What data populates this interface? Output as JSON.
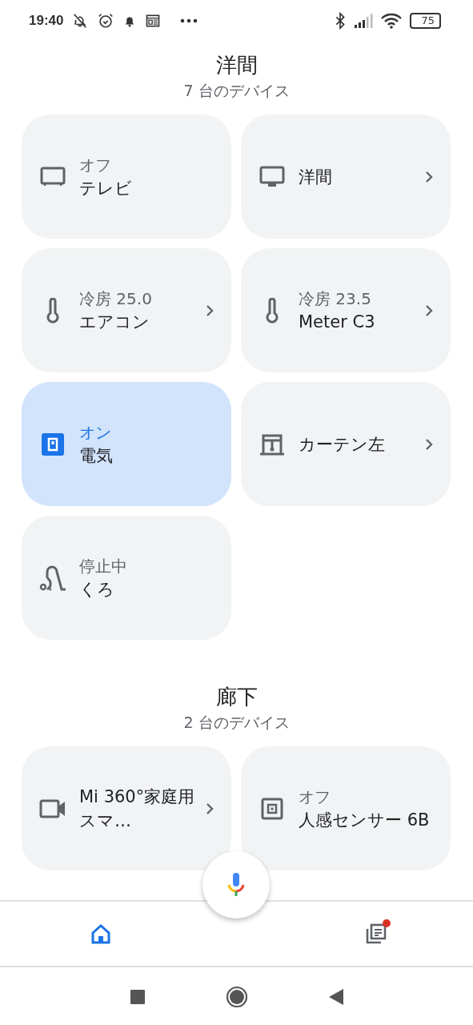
{
  "status_bar": {
    "time": "19:40",
    "battery": "75"
  },
  "rooms": [
    {
      "title": "洋間",
      "subtitle": "7 台のデバイス",
      "devices": [
        {
          "kind": "tv",
          "status": "オフ",
          "name": "テレビ",
          "on": false,
          "chevron": false
        },
        {
          "kind": "display",
          "name": "洋間",
          "on": false,
          "chevron": true
        },
        {
          "kind": "thermometer",
          "status": "冷房 25.0",
          "name": "エアコン",
          "on": false,
          "chevron": true
        },
        {
          "kind": "thermometer",
          "status": "冷房 23.5",
          "name": "Meter C3",
          "on": false,
          "chevron": true
        },
        {
          "kind": "switch",
          "status": "オン",
          "name": "電気",
          "on": true,
          "chevron": false
        },
        {
          "kind": "curtain",
          "name": "カーテン左",
          "on": false,
          "chevron": true
        },
        {
          "kind": "vacuum",
          "status": "停止中",
          "name": "くろ",
          "on": false,
          "chevron": false
        }
      ]
    },
    {
      "title": "廊下",
      "subtitle": "2 台のデバイス",
      "devices": [
        {
          "kind": "camera",
          "name": "Mi 360°家庭用スマ…",
          "on": false,
          "chevron": true
        },
        {
          "kind": "sensor",
          "status": "オフ",
          "name": "人感センサー 6B",
          "on": false,
          "chevron": false
        }
      ]
    }
  ],
  "bottom_nav": [
    {
      "kind": "home",
      "selected": true
    },
    {
      "kind": "feed",
      "selected": false,
      "badge": true
    }
  ]
}
